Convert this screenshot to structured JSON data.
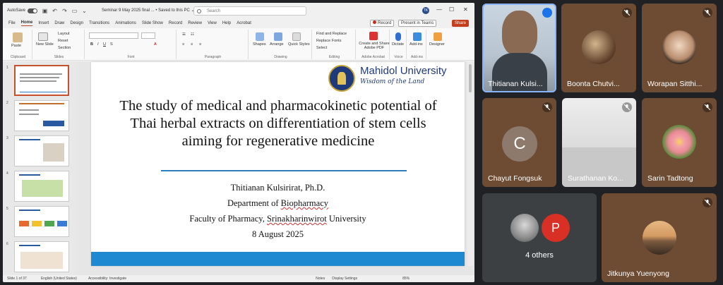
{
  "ppt": {
    "autosave_label": "AutoSave",
    "autosave_state": "Off",
    "doc_title": "Seminar 9 May 2025 final ... • Saved to this PC ⌄",
    "search_placeholder": "Search",
    "user_initials": "TK",
    "menu": [
      "File",
      "Home",
      "Insert",
      "Draw",
      "Design",
      "Transitions",
      "Animations",
      "Slide Show",
      "Record",
      "Review",
      "View",
      "Help",
      "Acrobat"
    ],
    "active_menu": "Home",
    "record_label": "Record",
    "present_teams_label": "Present in Teams",
    "share_label": "Share",
    "ribbon": {
      "clipboard": {
        "label": "Clipboard",
        "paste": "Paste"
      },
      "slides": {
        "label": "Slides",
        "new_slide": "New Slide",
        "layout": "Layout",
        "reset": "Reset",
        "section": "Section"
      },
      "font": {
        "label": "Font"
      },
      "paragraph": {
        "label": "Paragraph"
      },
      "drawing": {
        "label": "Drawing",
        "shapes": "Shapes",
        "arrange": "Arrange",
        "quick_styles": "Quick Styles"
      },
      "editing": {
        "label": "Editing",
        "find_replace": "Find and Replace",
        "replace_fonts": "Replace Fonts",
        "select": "Select"
      },
      "adobe": {
        "label": "Adobe Acrobat",
        "create_share": "Create and Share Adobe PDF"
      },
      "voice": {
        "label": "Voice",
        "dictate": "Dictate"
      },
      "addins": {
        "label": "Add-ins",
        "addins": "Add-ins"
      },
      "designer": {
        "designer": "Designer"
      }
    },
    "thumbnail_numbers": [
      "1",
      "2",
      "3",
      "4",
      "5",
      "6"
    ],
    "slide": {
      "university_name": "Mahidol University",
      "university_tagline": "Wisdom of the Land",
      "title": "The study of medical and pharmacokinetic potential of Thai herbal extracts on differentiation of stem cells aiming for regenerative medicine",
      "presenter": "Thitianan Kulsirirat, Ph.D.",
      "dept_prefix": "Department of ",
      "dept_name": "Biopharmacy",
      "faculty_prefix": "Faculty of Pharmacy, ",
      "faculty_uni": "Srinakharinwirot",
      "faculty_suffix": " University",
      "date": "8 August 2025"
    },
    "status": {
      "slide_count": "Slide 1 of 37",
      "language": "English (United States)",
      "accessibility": "Accessibility: Investigate",
      "notes": "Notes",
      "display_settings": "Display Settings",
      "zoom": "85%"
    }
  },
  "participants": [
    {
      "name": "Thitianan Kulsi...",
      "muted": false,
      "speaking": true
    },
    {
      "name": "Boonta Chutvi...",
      "muted": true
    },
    {
      "name": "Worapan Sitthi...",
      "muted": true
    },
    {
      "name": "Chayut Fongsuk",
      "muted": true,
      "initial": "C"
    },
    {
      "name": "Surathanan Ko...",
      "muted": true
    },
    {
      "name": "Sarin Tadtong",
      "muted": true
    },
    {
      "name": "4 others",
      "initial": "P"
    },
    {
      "name": "Jitkunya Yuenyong",
      "muted": true
    }
  ],
  "colors": {
    "ppt_accent": "#c43e1c",
    "slide_divider": "#2d7dc2",
    "slide_footer": "#1e88d0",
    "university_blue": "#1f3a7a",
    "tile_brown": "#6b4a33",
    "meeting_bg": "#202124"
  }
}
